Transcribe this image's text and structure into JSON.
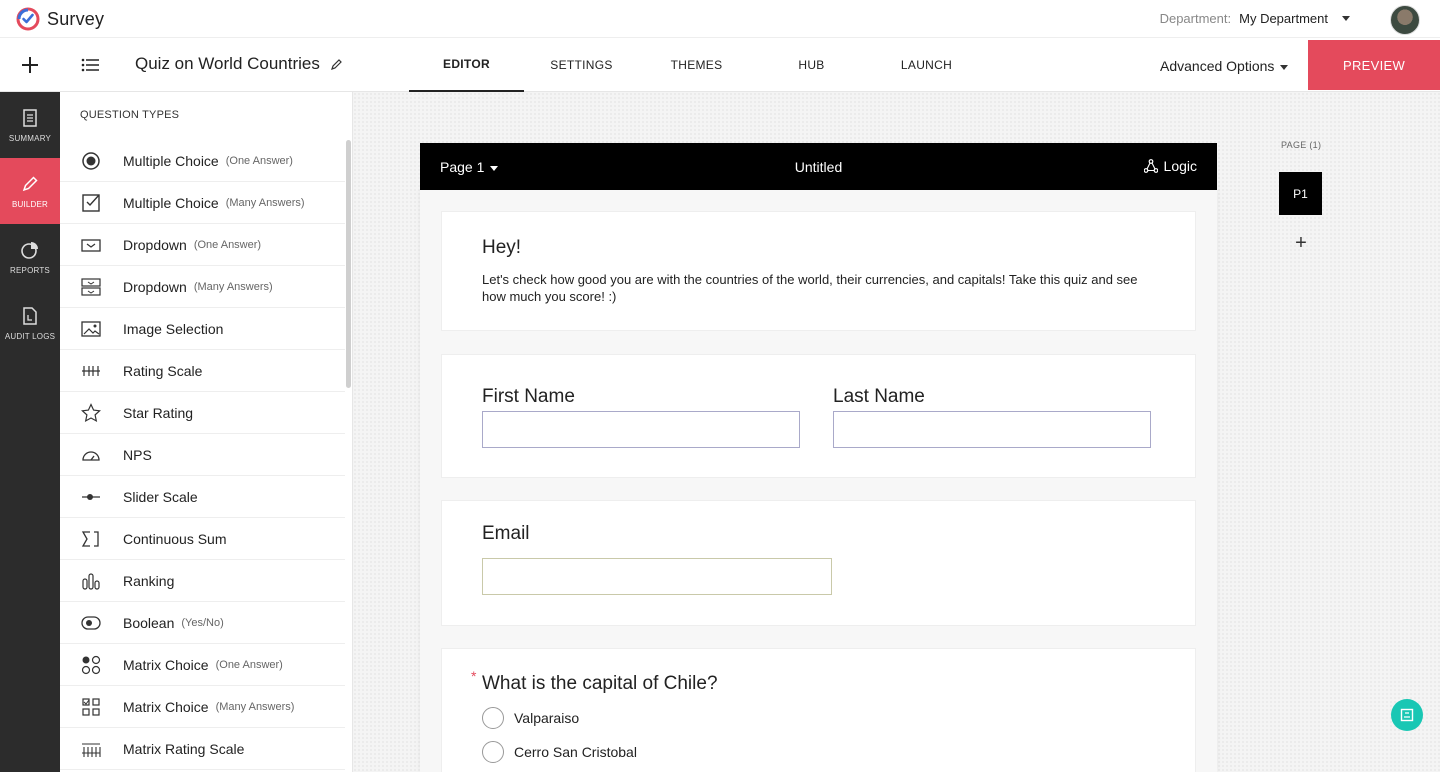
{
  "app": {
    "name": "Survey",
    "department_label": "Department:",
    "department_value": "My Department"
  },
  "toolbar": {
    "survey_title": "Quiz on World Countries",
    "tabs": [
      "EDITOR",
      "SETTINGS",
      "THEMES",
      "HUB",
      "LAUNCH"
    ],
    "active_tab": "EDITOR",
    "advanced_options": "Advanced Options",
    "preview": "PREVIEW"
  },
  "leftnav": [
    {
      "label": "SUMMARY",
      "icon": "summary-icon"
    },
    {
      "label": "BUILDER",
      "icon": "pencil-icon",
      "active": true
    },
    {
      "label": "REPORTS",
      "icon": "pie-chart-icon"
    },
    {
      "label": "AUDIT LOGS",
      "icon": "audit-log-icon"
    }
  ],
  "question_types": {
    "title": "QUESTION TYPES",
    "items": [
      {
        "label": "Multiple Choice",
        "sub": "(One Answer)",
        "icon": "radio-icon"
      },
      {
        "label": "Multiple Choice",
        "sub": "(Many Answers)",
        "icon": "checkbox-icon"
      },
      {
        "label": "Dropdown",
        "sub": "(One Answer)",
        "icon": "dropdown-icon"
      },
      {
        "label": "Dropdown",
        "sub": "(Many Answers)",
        "icon": "multi-dropdown-icon"
      },
      {
        "label": "Image Selection",
        "sub": "",
        "icon": "image-icon"
      },
      {
        "label": "Rating Scale",
        "sub": "",
        "icon": "rating-scale-icon"
      },
      {
        "label": "Star Rating",
        "sub": "",
        "icon": "star-icon"
      },
      {
        "label": "NPS",
        "sub": "",
        "icon": "gauge-icon"
      },
      {
        "label": "Slider Scale",
        "sub": "",
        "icon": "slider-icon"
      },
      {
        "label": "Continuous Sum",
        "sub": "",
        "icon": "sum-icon"
      },
      {
        "label": "Ranking",
        "sub": "",
        "icon": "ranking-icon"
      },
      {
        "label": "Boolean",
        "sub": "(Yes/No)",
        "icon": "toggle-icon"
      },
      {
        "label": "Matrix Choice",
        "sub": "(One Answer)",
        "icon": "matrix-radio-icon"
      },
      {
        "label": "Matrix Choice",
        "sub": "(Many Answers)",
        "icon": "matrix-checkbox-icon"
      },
      {
        "label": "Matrix Rating Scale",
        "sub": "",
        "icon": "matrix-rating-icon"
      }
    ]
  },
  "page": {
    "selector": "Page 1",
    "name": "Untitled",
    "logic": "Logic",
    "welcome": {
      "title": "Hey!",
      "text": "Let's check how good you are with the countries of the world, their currencies, and capitals! Take this quiz and see how much you score! :)"
    },
    "fields": {
      "first_name": "First Name",
      "last_name": "Last Name",
      "email": "Email"
    },
    "question": {
      "required_mark": "*",
      "title": "What is the capital of Chile?",
      "options": [
        "Valparaiso",
        "Cerro San Cristobal"
      ]
    }
  },
  "pages_panel": {
    "label": "PAGE (1)",
    "items": [
      "P1"
    ],
    "add": "+"
  },
  "colors": {
    "accent": "#e44a5c",
    "nav_bg": "#2c2c2c",
    "fab": "#19c7b4"
  }
}
